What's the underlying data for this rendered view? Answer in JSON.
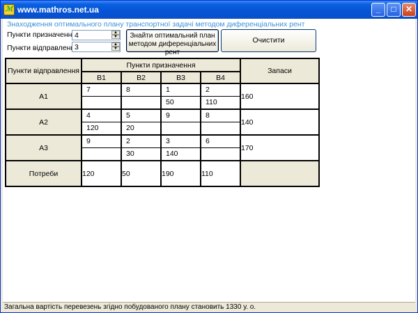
{
  "window": {
    "title": "www.mathros.net.ua",
    "icon_label": "ℳ"
  },
  "form": {
    "heading": "Знаходження оптимального плану транспортної задачі методом диференціальних рент",
    "destinations_label": "Пункти призначення :",
    "destinations_value": "4",
    "origins_label": "Пункти відправлення :",
    "origins_value": "3",
    "solve_button": "Знайти оптимальний план методом диференціальних рент",
    "solve_line1": "Знайти оптимальний план",
    "solve_line2": "методом диференціальних рент",
    "clear_button": "Очистити"
  },
  "table": {
    "origins_header": "Пункти відправлення",
    "destinations_header": "Пункти призначення",
    "supply_header": "Запаси",
    "demand_header": "Потреби",
    "columns": [
      "B1",
      "B2",
      "B3",
      "B4"
    ],
    "rows": [
      {
        "name": "A1",
        "costs": [
          "7",
          "8",
          "1",
          "2"
        ],
        "alloc": [
          "",
          "",
          "50",
          "110"
        ],
        "supply": "160"
      },
      {
        "name": "A2",
        "costs": [
          "4",
          "5",
          "9",
          "8"
        ],
        "alloc": [
          "120",
          "20",
          "",
          ""
        ],
        "supply": "140"
      },
      {
        "name": "A3",
        "costs": [
          "9",
          "2",
          "3",
          "6"
        ],
        "alloc": [
          "",
          "30",
          "140",
          ""
        ],
        "supply": "170"
      }
    ],
    "demand": [
      "120",
      "50",
      "190",
      "110"
    ]
  },
  "status": {
    "text": "Загальна вартість перевезень згідно побудованого плану становить 1330 у. о."
  }
}
